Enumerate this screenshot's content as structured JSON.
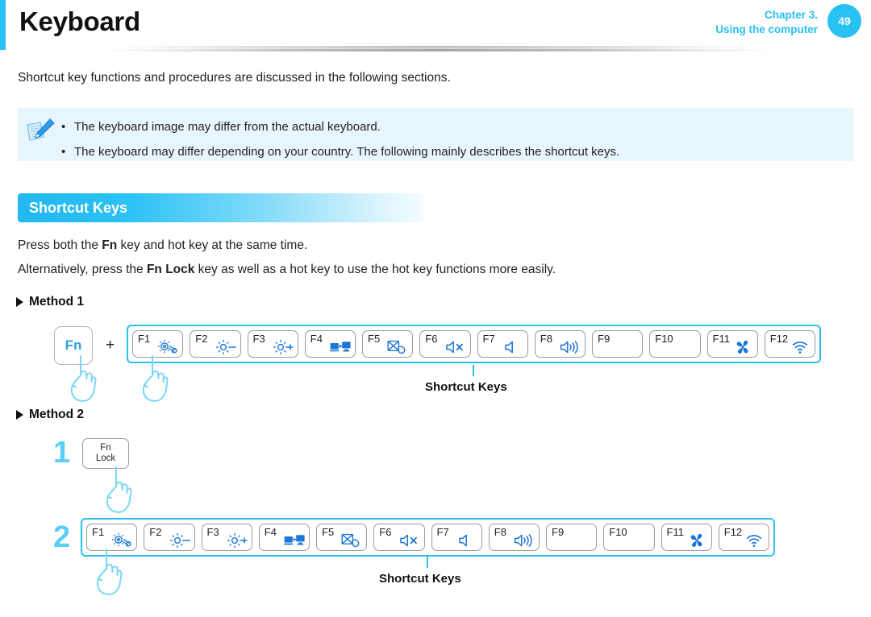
{
  "header": {
    "title": "Keyboard",
    "chapter_line1": "Chapter 3.",
    "chapter_line2": "Using the computer",
    "page_number": "49",
    "accent_color": "#29c0f4"
  },
  "intro": "Shortcut key functions and procedures are discussed in the following sections.",
  "note": {
    "icon": "note-pencil-icon",
    "bullet": "•",
    "items": [
      "The keyboard image may differ from the actual keyboard.",
      "The keyboard may differ depending on your country. The following mainly describes the shortcut keys."
    ]
  },
  "section": {
    "title": "Shortcut Keys"
  },
  "paragraphs": {
    "p1_pre": "Press both the ",
    "p1_bold": "Fn",
    "p1_post": " key and hot key at the same time.",
    "p2_pre": "Alternatively, press the ",
    "p2_bold": "Fn Lock",
    "p2_post": " key as well as a hot key to use the hot key functions more easily."
  },
  "method1": {
    "heading": "Method 1",
    "fn_key_label": "Fn",
    "plus": "+",
    "callout": "Shortcut Keys"
  },
  "method2": {
    "heading": "Method 2",
    "step1_number": "1",
    "step2_number": "2",
    "fnlock_line1": "Fn",
    "fnlock_line2": "Lock",
    "callout": "Shortcut Keys"
  },
  "function_keys": [
    {
      "label": "F1",
      "icon": "settings-gear-icon"
    },
    {
      "label": "F2",
      "icon": "brightness-down-icon"
    },
    {
      "label": "F3",
      "icon": "brightness-up-icon"
    },
    {
      "label": "F4",
      "icon": "display-output-icon"
    },
    {
      "label": "F5",
      "icon": "touchpad-off-icon"
    },
    {
      "label": "F6",
      "icon": "volume-mute-icon"
    },
    {
      "label": "F7",
      "icon": "volume-down-icon"
    },
    {
      "label": "F8",
      "icon": "volume-up-icon"
    },
    {
      "label": "F9",
      "icon": ""
    },
    {
      "label": "F10",
      "icon": ""
    },
    {
      "label": "F11",
      "icon": "fan-silent-mode-icon"
    },
    {
      "label": "F12",
      "icon": "wifi-icon"
    }
  ],
  "colors": {
    "accent": "#29c0f4",
    "key_icon_blue": "#1b76d6",
    "note_bg": "#e7f6fd",
    "hand_outline": "#7fd8f7",
    "step_number": "#5ccdf7"
  }
}
